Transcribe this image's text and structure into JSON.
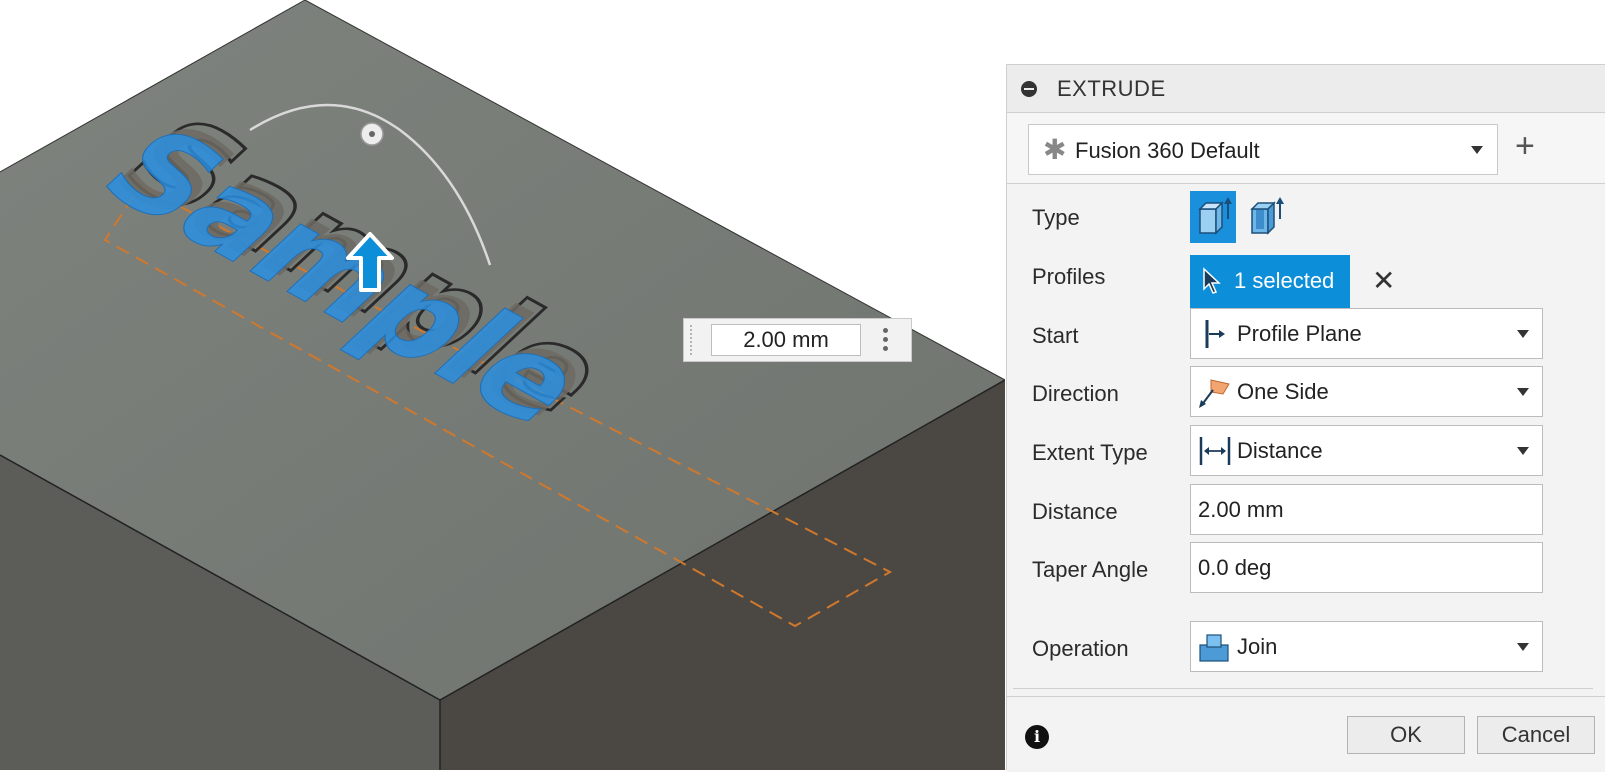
{
  "viewport": {
    "model_text": "Sample",
    "distance_manipulator_value": "2.00 mm"
  },
  "panel": {
    "title": "EXTRUDE",
    "preset": {
      "value": "Fusion 360 Default",
      "add_label": "+"
    },
    "rows": {
      "type": {
        "label": "Type"
      },
      "profiles": {
        "label": "Profiles",
        "value": "1 selected",
        "clear": "✕"
      },
      "start": {
        "label": "Start",
        "value": "Profile Plane"
      },
      "direction": {
        "label": "Direction",
        "value": "One Side"
      },
      "extent_type": {
        "label": "Extent Type",
        "value": "Distance"
      },
      "distance": {
        "label": "Distance",
        "value": "2.00 mm"
      },
      "taper_angle": {
        "label": "Taper Angle",
        "value": "0.0 deg"
      },
      "operation": {
        "label": "Operation",
        "value": "Join"
      }
    },
    "footer": {
      "info": "i",
      "ok_label": "OK",
      "cancel_label": "Cancel"
    }
  },
  "colors": {
    "accent": "#0c8ed9",
    "body_top": "#777b76",
    "body_front": "#5a5a57",
    "body_side": "#4a4741",
    "extrude_blue": "#2c8fe0",
    "sketch_line": "#d0782c"
  }
}
